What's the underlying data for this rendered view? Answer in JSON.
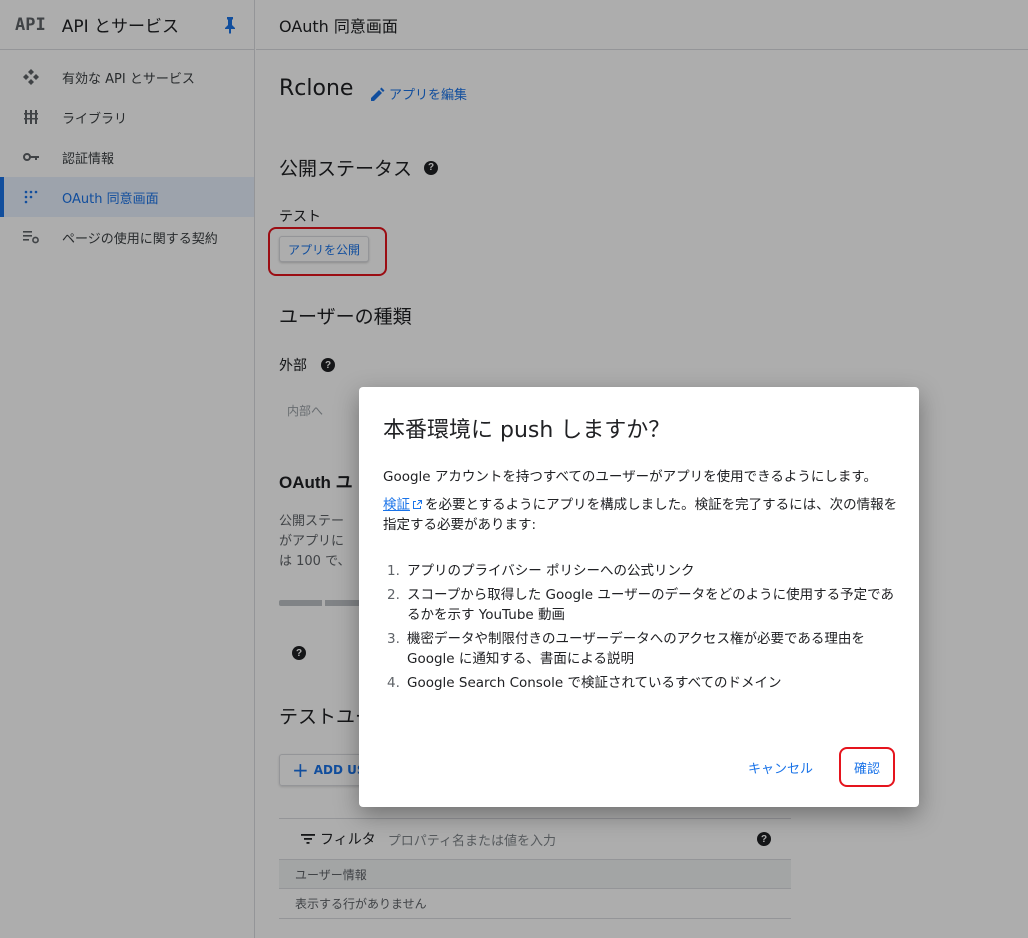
{
  "sidebar": {
    "logo": "API",
    "title": "API とサービス",
    "items": [
      {
        "label": "有効な API とサービス",
        "icon": "apis-icon",
        "active": false
      },
      {
        "label": "ライブラリ",
        "icon": "library-icon",
        "active": false
      },
      {
        "label": "認証情報",
        "icon": "key-icon",
        "active": false
      },
      {
        "label": "OAuth 同意画面",
        "icon": "consent-icon",
        "active": true
      },
      {
        "label": "ページの使用に関する契約",
        "icon": "settings-list-icon",
        "active": false
      }
    ]
  },
  "topbar": {
    "title": "OAuth 同意画面"
  },
  "main": {
    "app_name": "Rclone",
    "edit_link": "アプリを編集",
    "publish_status_title": "公開ステータス",
    "status_value": "テスト",
    "publish_button": "アプリを公開",
    "user_type_title": "ユーザーの種類",
    "user_type_value": "外部",
    "internal_button": "内部へ",
    "oauth_limit_title": "OAuth ユ",
    "para_frag_1": "公開ステー",
    "para_frag_2": "がアプリに",
    "para_frag_3": "は 100 で、",
    "test_users_title": "テストユー",
    "add_users_button": "ADD USERS",
    "filter_label": "フィルタ",
    "filter_placeholder": "プロパティ名または値を入力",
    "table_header": "ユーザー情報",
    "table_empty": "表示する行がありません"
  },
  "dialog": {
    "title": "本番環境に push しますか？",
    "para1": "Google アカウントを持つすべてのユーザーがアプリを使用できるようにします。",
    "verify_link": "検証",
    "para2_rest": "を必要とするようにアプリを構成しました。検証を完了するには、次の情報を指定する必要があります:",
    "requirements": [
      {
        "num": "1.",
        "text": "アプリのプライバシー ポリシーへの公式リンク"
      },
      {
        "num": "2.",
        "text": "スコープから取得した Google ユーザーのデータをどのように使用する予定であるかを示す YouTube 動画"
      },
      {
        "num": "3.",
        "text": "機密データや制限付きのユーザーデータへのアクセス権が必要である理由を Google に通知する、書面による説明"
      },
      {
        "num": "4.",
        "text": "Google Search Console で検証されているすべてのドメイン"
      }
    ],
    "cancel_button": "キャンセル",
    "confirm_button": "確認"
  },
  "colors": {
    "accent": "#1a73e8",
    "highlight": "#e5141d",
    "scrim": "rgba(0,0,0,0.32)"
  }
}
